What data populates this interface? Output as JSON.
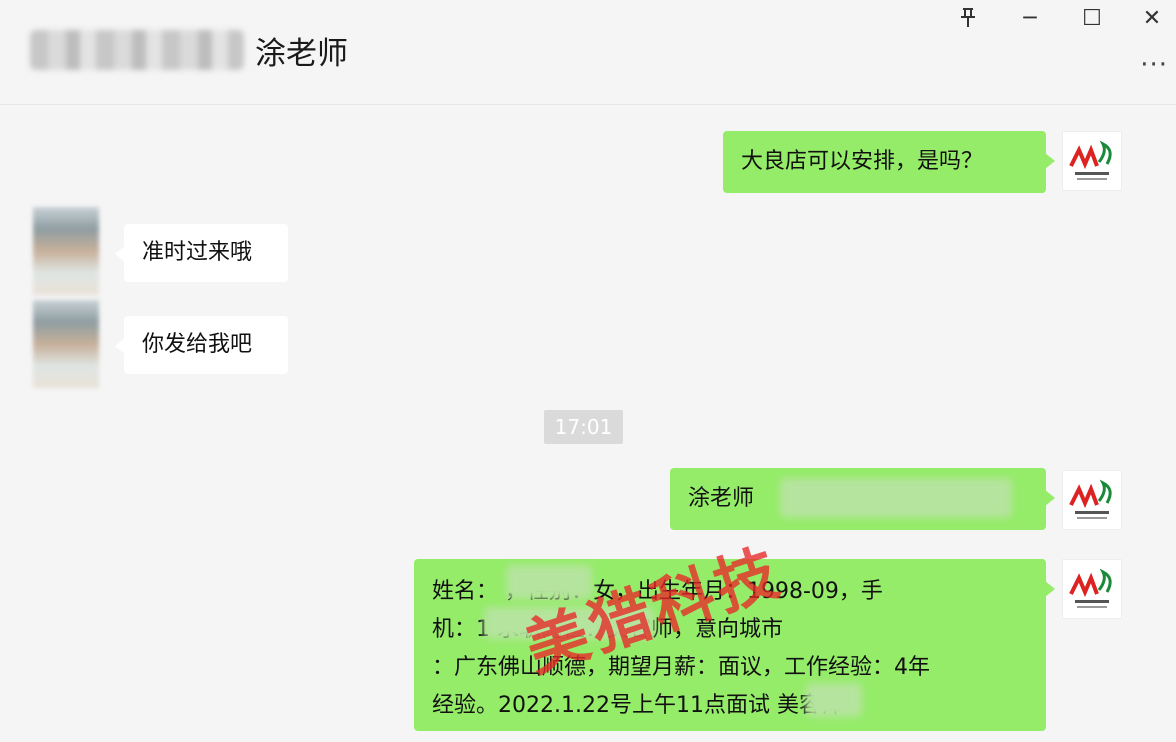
{
  "header": {
    "contact_name": "涂老师",
    "pin_icon": "pin-icon",
    "minimize": "─",
    "maximize": "☐",
    "close": "✕",
    "more": "···"
  },
  "messages": [
    {
      "side": "right",
      "text": "大良店可以安排，是吗？"
    },
    {
      "side": "left",
      "text": "准时过来哦"
    },
    {
      "side": "left",
      "text": "你发给我吧"
    },
    {
      "side": "right",
      "text": "涂老师"
    },
    {
      "side": "right",
      "lines": [
        "姓名：          ，性别：女，出生年月：1998-09，手",
        "机：1                求职岗位：美容师，意向城市",
        "：广东佛山顺德，期望月薪：面议，工作经验：4年",
        "经验。2022.1.22号上午11点面试          美容师"
      ]
    }
  ],
  "timestamp": "17:01",
  "watermark": "美猎科技",
  "colors": {
    "sent_bubble": "#95ec69",
    "received_bubble": "#ffffff",
    "watermark": "#e82828"
  }
}
